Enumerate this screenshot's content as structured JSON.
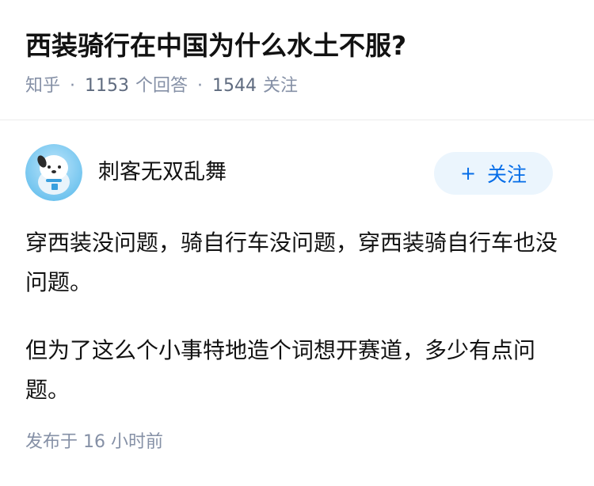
{
  "question": {
    "title": "西装骑行在中国为什么水土不服?",
    "source": "知乎",
    "answer_count": "1153",
    "answer_label": "个回答",
    "follower_count": "1544",
    "follower_label": "关注"
  },
  "answer": {
    "author_name": "刺客无双乱舞",
    "follow_button_label": "关注",
    "paragraphs": [
      "穿西装没问题，骑自行车没问题，穿西装骑自行车也没问题。",
      "但为了这么个小事特地造个词想开赛道，多少有点问题。"
    ],
    "publish_label": "发布于",
    "publish_time": "16 小时前"
  },
  "colors": {
    "accent": "#056de8",
    "follow_bg": "#ebf5fd",
    "meta": "#8590a6"
  }
}
